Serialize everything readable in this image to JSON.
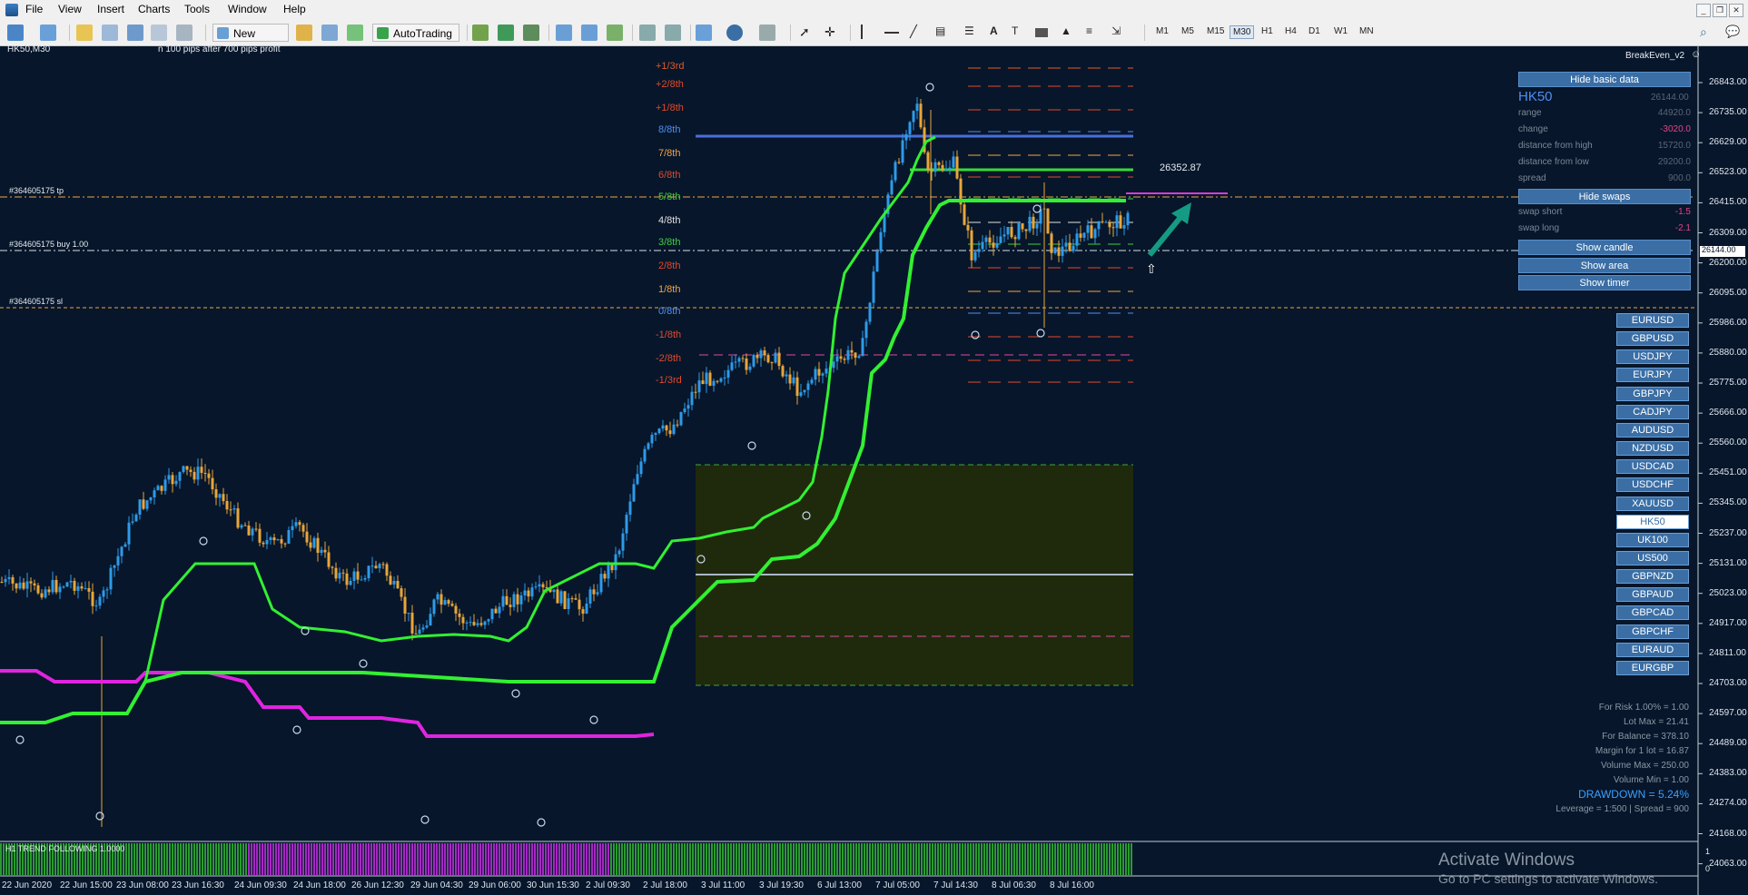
{
  "menu": [
    "File",
    "View",
    "Insert",
    "Charts",
    "Tools",
    "Window",
    "Help"
  ],
  "toolbar": {
    "new_order": "New Order",
    "auto_trading": "AutoTrading"
  },
  "timeframes": [
    "M1",
    "M5",
    "M15",
    "M30",
    "H1",
    "H4",
    "D1",
    "W1",
    "MN"
  ],
  "active_timeframe": "M30",
  "chart": {
    "symbol_tf": "HK50,M30",
    "comment": "n 100 pips after 700 pips profit",
    "expert": "BreakEven_v2",
    "tp_label": "#364605175 tp",
    "buy_label": "#364605175 buy 1.00",
    "sl_label": "#364605175 sl",
    "target_price": "26352.87",
    "current_price": "26144.00",
    "indicator_label": "H1 TREND FOLLOWING 1.0000",
    "indicator_scale_top": "1",
    "indicator_scale_bottom": "0",
    "price_axis": [
      "26843.00",
      "26735.00",
      "26629.00",
      "26523.00",
      "26415.00",
      "26309.00",
      "26200.00",
      "26095.00",
      "25986.00",
      "25880.00",
      "25775.00",
      "25666.00",
      "25560.00",
      "25451.00",
      "25345.00",
      "25237.00",
      "25131.00",
      "25023.00",
      "24917.00",
      "24811.00",
      "24703.00",
      "24597.00",
      "24489.00",
      "24383.00",
      "24274.00",
      "24168.00",
      "24063.00"
    ],
    "date_axis": [
      "22 Jun 2020",
      "22 Jun 15:00",
      "23 Jun 08:00",
      "23 Jun 16:30",
      "24 Jun 09:30",
      "24 Jun 18:00",
      "26 Jun 12:30",
      "29 Jun 04:30",
      "29 Jun 06:00",
      "30 Jun 15:30",
      "2 Jul 09:30",
      "2 Jul 18:00",
      "3 Jul 11:00",
      "3 Jul 19:30",
      "6 Jul 13:00",
      "7 Jul 05:00",
      "7 Jul 14:30",
      "8 Jul 06:30",
      "8 Jul 16:00"
    ]
  },
  "murrey": [
    {
      "label": "+1/3rd",
      "color": "#e05a2b"
    },
    {
      "label": "+2/8th",
      "color": "#e04a2b"
    },
    {
      "label": "+1/8th",
      "color": "#e04a2b"
    },
    {
      "label": "8/8th",
      "color": "#4f8ff0"
    },
    {
      "label": "7/8th",
      "color": "#f2a640"
    },
    {
      "label": "6/8th",
      "color": "#e04a2b"
    },
    {
      "label": "5/8th",
      "color": "#3fcf3f"
    },
    {
      "label": "4/8th",
      "color": "#e0e0e0"
    },
    {
      "label": "3/8th",
      "color": "#3fcf3f"
    },
    {
      "label": "2/8th",
      "color": "#e04a2b"
    },
    {
      "label": "1/8th",
      "color": "#f2a640"
    },
    {
      "label": "0/8th",
      "color": "#4f8ff0"
    },
    {
      "label": "-1/8th",
      "color": "#e04a2b"
    },
    {
      "label": "-2/8th",
      "color": "#e04a2b"
    },
    {
      "label": "-1/3rd",
      "color": "#e04a2b"
    }
  ],
  "panel": {
    "hide_basic": "Hide basic data",
    "symbol": "HK50",
    "symbol_price": "26144.00",
    "rows": [
      {
        "key": "range",
        "value": "44920.0",
        "color": "#5a6675"
      },
      {
        "key": "change",
        "value": "-3020.0",
        "color": "#e0468a"
      },
      {
        "key": "distance from high",
        "value": "15720.0",
        "color": "#5a6675"
      },
      {
        "key": "distance from low",
        "value": "29200.0",
        "color": "#5a6675"
      },
      {
        "key": "spread",
        "value": "900.0",
        "color": "#5a6675"
      }
    ],
    "hide_swaps": "Hide swaps",
    "swaps": [
      {
        "key": "swap short",
        "value": "-1.5",
        "color": "#e0468a"
      },
      {
        "key": "swap long",
        "value": "-2.1",
        "color": "#e0468a"
      }
    ],
    "show_candle": "Show candle",
    "show_area": "Show area",
    "show_timer": "Show timer"
  },
  "symbols": [
    "EURUSD",
    "GBPUSD",
    "USDJPY",
    "EURJPY",
    "GBPJPY",
    "CADJPY",
    "AUDUSD",
    "NZDUSD",
    "USDCAD",
    "USDCHF",
    "XAUUSD",
    "HK50",
    "UK100",
    "US500",
    "GBPNZD",
    "GBPAUD",
    "GBPCAD",
    "GBPCHF",
    "EURAUD",
    "EURGBP"
  ],
  "selected_symbol": "HK50",
  "risk": [
    "For Risk 1.00% = 1.00",
    "Lot Max = 21.41",
    "For Balance = 378.10",
    "Margin for 1 lot = 16.87",
    "Volume Max = 250.00",
    "Volume Min = 1.00"
  ],
  "drawdown": "DRAWDOWN = 5.24%",
  "leverage": "Leverage = 1:500 | Spread = 900",
  "watermark": {
    "title": "Activate Windows",
    "sub": "Go to PC settings to activate Windows."
  }
}
